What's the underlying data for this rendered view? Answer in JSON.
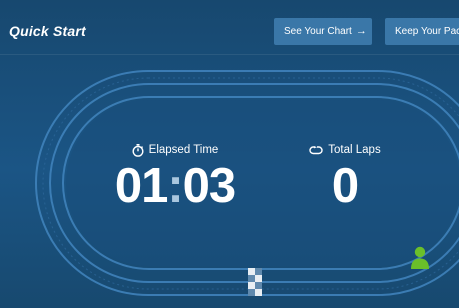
{
  "header": {
    "title": "Quick Start",
    "see_chart_label": "See Your Chart",
    "see_chart_arrow": "→",
    "keep_pace_label": "Keep Your Pace"
  },
  "stats": {
    "elapsed": {
      "label": "Elapsed Time",
      "value_minutes": "01",
      "value_separator": ":",
      "value_seconds": "03",
      "icon": "stopwatch-icon"
    },
    "laps": {
      "label": "Total Laps",
      "value": "0",
      "icon": "loop-icon"
    }
  },
  "track": {
    "runner_icon": "runner-avatar-icon",
    "finish_icon": "checkered-flag-icon"
  },
  "colors": {
    "background": "#1b5585",
    "button": "#3a77a8",
    "track_line": "#4a8cc4",
    "runner": "#6bbf2a",
    "colon_accent": "#a9c6de"
  }
}
